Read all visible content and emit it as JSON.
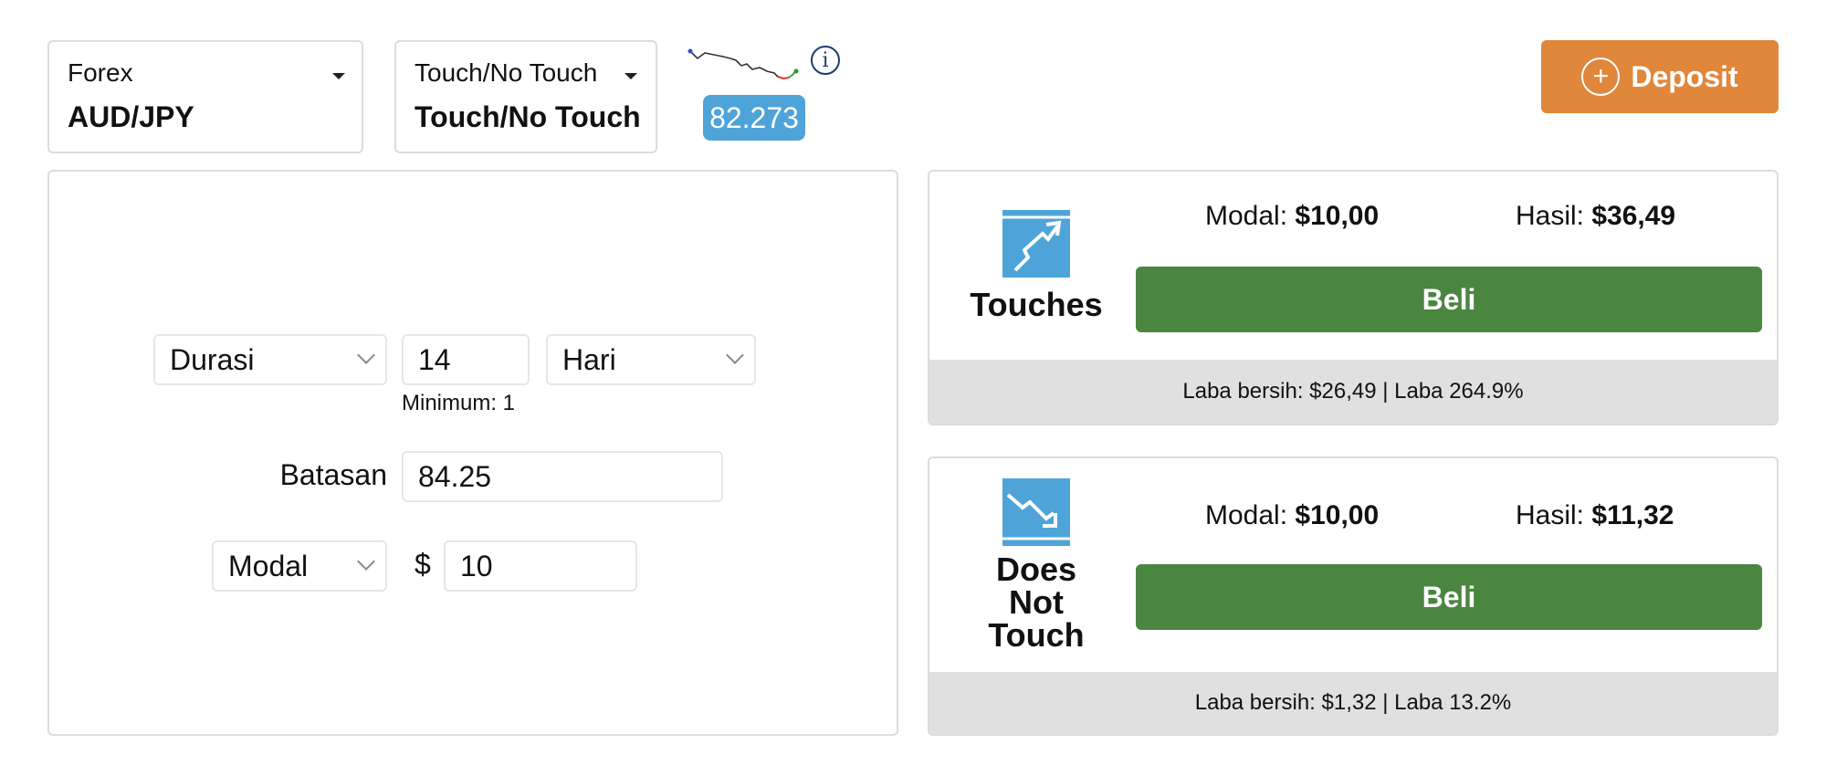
{
  "market_selector": {
    "category": "Forex",
    "value": "AUD/JPY"
  },
  "contract_type_selector": {
    "category": "Touch/No Touch",
    "value": "Touch/No Touch"
  },
  "price_badge": "82.273",
  "deposit_button": {
    "label": "Deposit",
    "color": "#e0873c"
  },
  "form": {
    "duration_type": "Durasi",
    "duration_value": "14",
    "duration_unit": "Hari",
    "duration_hint": "Minimum: 1",
    "barrier_label": "Batasan",
    "barrier_value": "84.25",
    "stake_type": "Modal",
    "currency_symbol": "$",
    "stake_value": "10"
  },
  "contracts": [
    {
      "name": "Touches",
      "stake_label": "Modal:",
      "stake_amount": "$10,00",
      "payout_label": "Hasil:",
      "payout_amount": "$36,49",
      "buy_label": "Beli",
      "footer": "Laba bersih: $26,49 | Laba 264.9%"
    },
    {
      "name": "Does Not Touch",
      "stake_label": "Modal:",
      "stake_amount": "$10,00",
      "payout_label": "Hasil:",
      "payout_amount": "$11,32",
      "buy_label": "Beli",
      "footer": "Laba bersih: $1,32 | Laba 13.2%"
    }
  ],
  "colors": {
    "accent_blue": "#4ea4d9",
    "buy_green": "#4a8640",
    "deposit_orange": "#e0873c",
    "footer_gray": "#e0e0e0"
  },
  "icons": {
    "info": "info-icon",
    "deposit": "plus-circle-icon",
    "touch": "arrow-up-touch-icon",
    "no_touch": "arrow-down-no-touch-icon"
  }
}
